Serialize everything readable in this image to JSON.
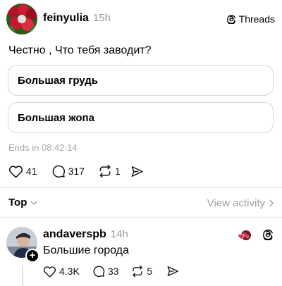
{
  "post": {
    "username": "feinyulia",
    "time": "15h",
    "question": "Честно , Что тебя заводит?",
    "options": [
      "Большая грудь",
      "Большая жопа"
    ],
    "ends": "Ends in 08:42:14",
    "likes": "41",
    "comments": "317",
    "reposts": "1"
  },
  "brand": {
    "label": "Threads"
  },
  "sort": {
    "label": "Top",
    "view_activity": "View activity"
  },
  "reply": {
    "username": "andaverspb",
    "time": "14h",
    "text": "Большие города",
    "likes": "4.3K",
    "comments": "33",
    "reposts": "5"
  },
  "icons": [
    "flower-avatar",
    "threads-logo-icon",
    "heart-icon",
    "comment-icon",
    "repost-icon",
    "share-icon",
    "chevron-down-icon",
    "chevron-right-icon",
    "plus-icon",
    "liked-by-author-icon"
  ],
  "colors": {
    "muted": "#999999",
    "border": "#d8d8d8",
    "heart_red": "#e0245e"
  }
}
